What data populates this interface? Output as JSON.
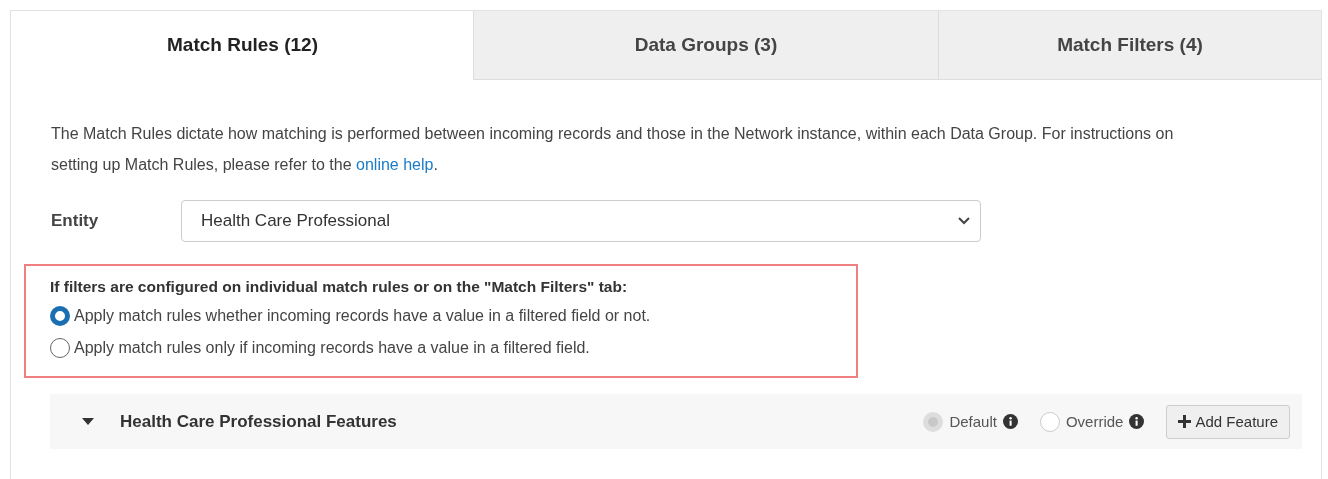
{
  "tabs": [
    {
      "label": "Match Rules (12)",
      "selected": true
    },
    {
      "label": "Data Groups (3)",
      "selected": false
    },
    {
      "label": "Match Filters (4)",
      "selected": false
    }
  ],
  "description": {
    "text": "The Match Rules dictate how matching is performed between incoming records and those in the Network instance, within each Data Group. For instructions on setting up Match Rules, please refer to the ",
    "link": "online help",
    "after": "."
  },
  "entity": {
    "label": "Entity",
    "value": "Health Care Professional"
  },
  "filter_option": {
    "heading": "If filters are configured on individual match rules or on the \"Match Filters\" tab:",
    "options": [
      {
        "label": "Apply match rules whether incoming records have a value in a filtered field or not.",
        "selected": true
      },
      {
        "label": "Apply match rules only if incoming records have a value in a filtered field.",
        "selected": false
      }
    ]
  },
  "features": {
    "title": "Health Care Professional Features",
    "expanded": true,
    "modes": [
      {
        "label": "Default",
        "selected": true,
        "disabled": true
      },
      {
        "label": "Override",
        "selected": false,
        "disabled": true
      }
    ],
    "button": "Add Feature"
  }
}
